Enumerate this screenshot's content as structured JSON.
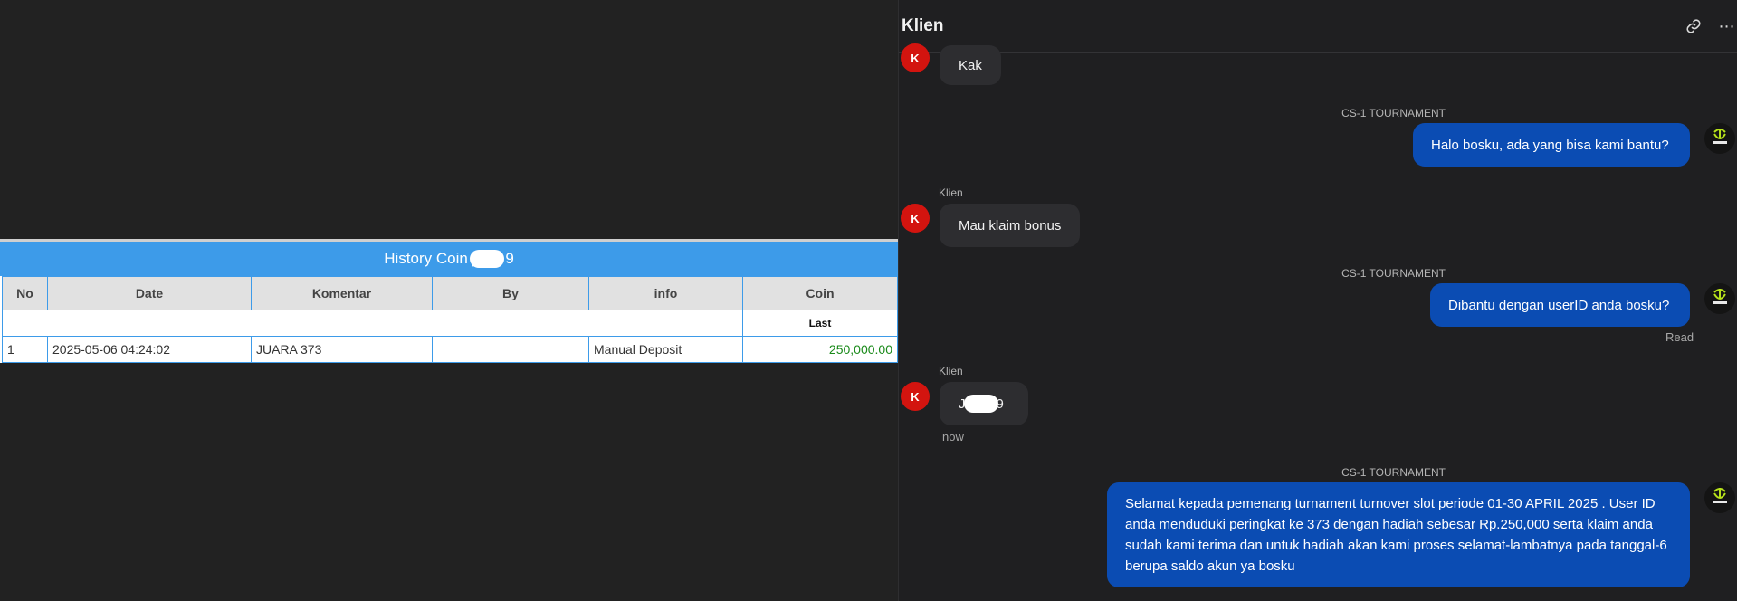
{
  "history": {
    "title_prefix": "History Coin j",
    "title_suffix": "9",
    "columns": [
      "No",
      "Date",
      "Komentar",
      "By",
      "info",
      "Coin"
    ],
    "last_label": "Last",
    "rows": [
      {
        "no": "1",
        "date": "2025-05-06 04:24:02",
        "komentar": "JUARA 373",
        "by": "",
        "info": "Manual Deposit",
        "coin": "250,000.00"
      }
    ]
  },
  "chat": {
    "title": "Klien",
    "messages": {
      "m1": {
        "avatar": "K",
        "text": "Kak"
      },
      "m2": {
        "sender": "CS-1 TOURNAMENT",
        "text": "Halo bosku, ada yang bisa kami bantu?"
      },
      "m3": {
        "sender": "Klien",
        "avatar": "K",
        "text": "Mau klaim bonus"
      },
      "m4": {
        "sender": "CS-1 TOURNAMENT",
        "text": "Dibantu dengan userID anda bosku?",
        "status": "Read"
      },
      "m5": {
        "sender": "Klien",
        "avatar": "K",
        "text_prefix": "J",
        "text_suffix": "9",
        "time": "now"
      },
      "m6": {
        "sender": "CS-1 TOURNAMENT",
        "text": "Selamat kepada pemenang turnament turnover slot periode 01-30 APRIL 2025 . User ID anda menduduki peringkat ke 373 dengan hadiah sebesar Rp.250,000 serta klaim anda sudah kami terima dan untuk hadiah akan kami proses selamat-lambatnya pada tanggal-6 berupa saldo akun ya bosku"
      }
    }
  },
  "colors": {
    "table_header": "#3d9be9",
    "agent_bubble": "#0b4cb3",
    "client_bubble": "#2d2d30",
    "avatar_red": "#d3140f",
    "coin_green": "#1a8a1a"
  },
  "icons": [
    "link-icon",
    "more-icon",
    "bot-logo-icon"
  ]
}
